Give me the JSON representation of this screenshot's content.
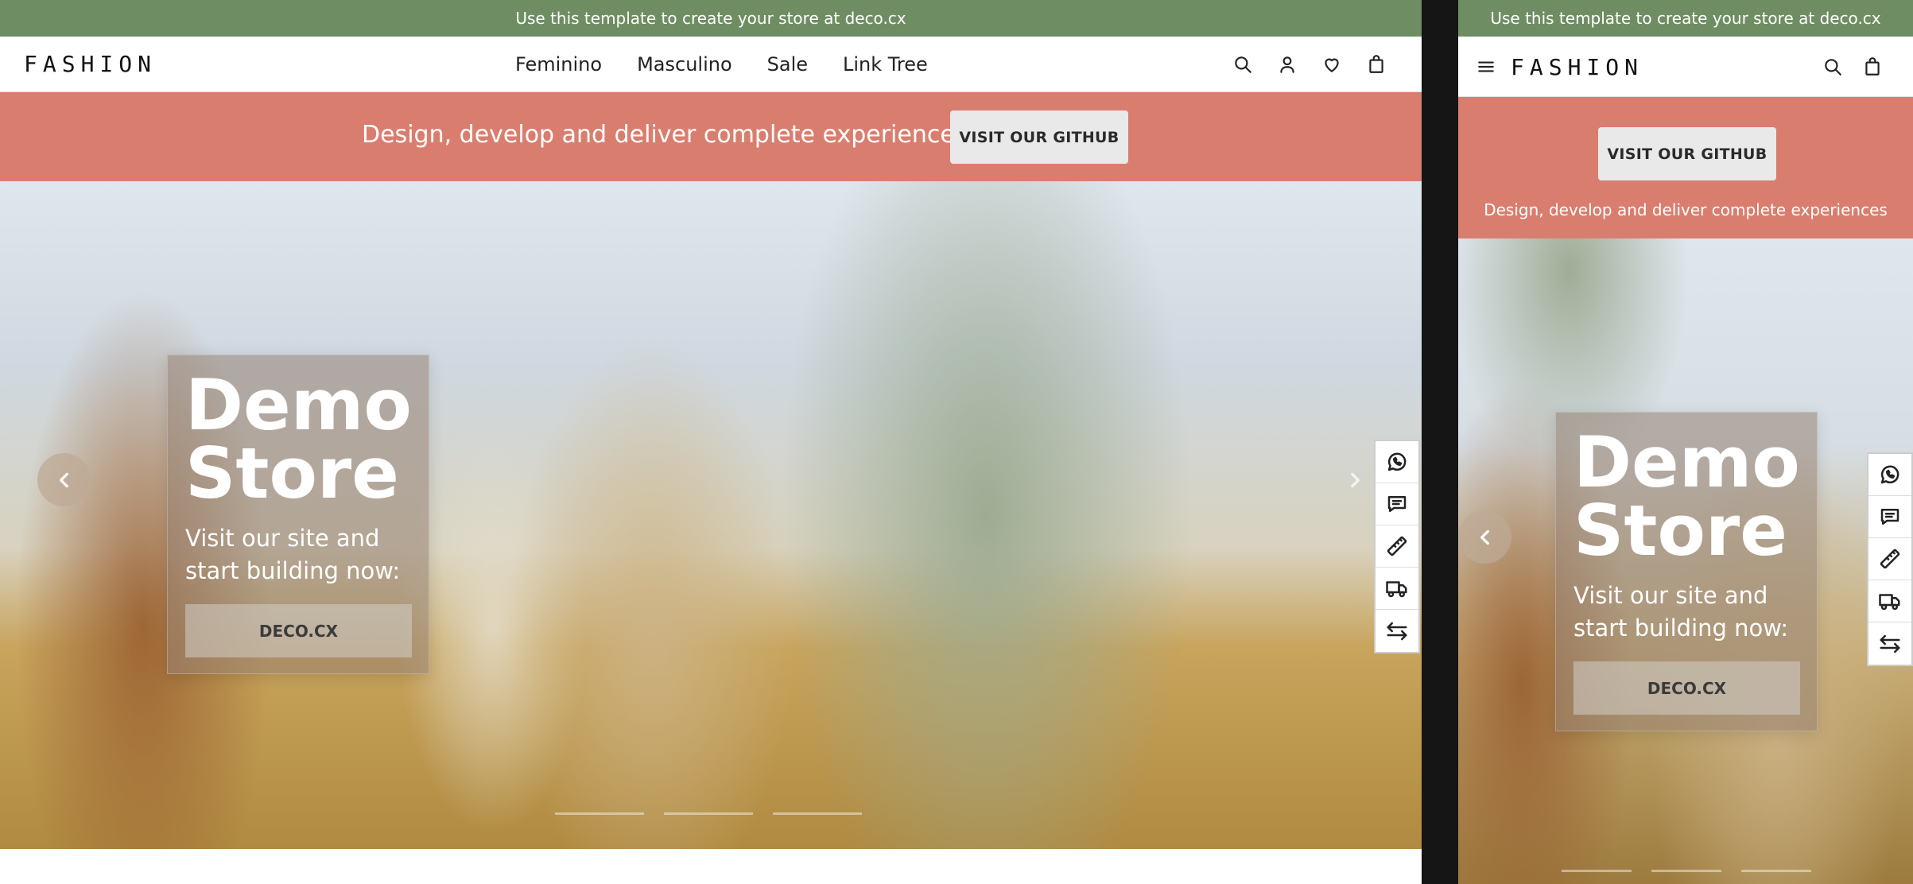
{
  "announcement": "Use this template to create your store at deco.cx",
  "logo": "FASHION",
  "nav": [
    "Feminino",
    "Masculino",
    "Sale",
    "Link Tree"
  ],
  "promo": {
    "text": "Design, develop and deliver complete experiences",
    "button": "VISIT OUR GITHUB"
  },
  "hero": {
    "title_line1": "Demo",
    "title_line2": "Store",
    "subtitle": "Visit our site and start building now:",
    "button": "DECO.CX",
    "slide_count": 3
  },
  "header_icons": [
    "search-icon",
    "user-icon",
    "heart-icon",
    "bag-icon"
  ],
  "mobile_header_icons": [
    "menu-icon",
    "search-icon",
    "bag-icon"
  ],
  "floating_actions": [
    "whatsapp-icon",
    "chat-icon",
    "ruler-icon",
    "truck-icon",
    "exchange-icon"
  ],
  "colors": {
    "announcement_bg": "#6f8d63",
    "promo_bg": "#d97e6f",
    "github_button_bg": "#e9e9e9"
  }
}
